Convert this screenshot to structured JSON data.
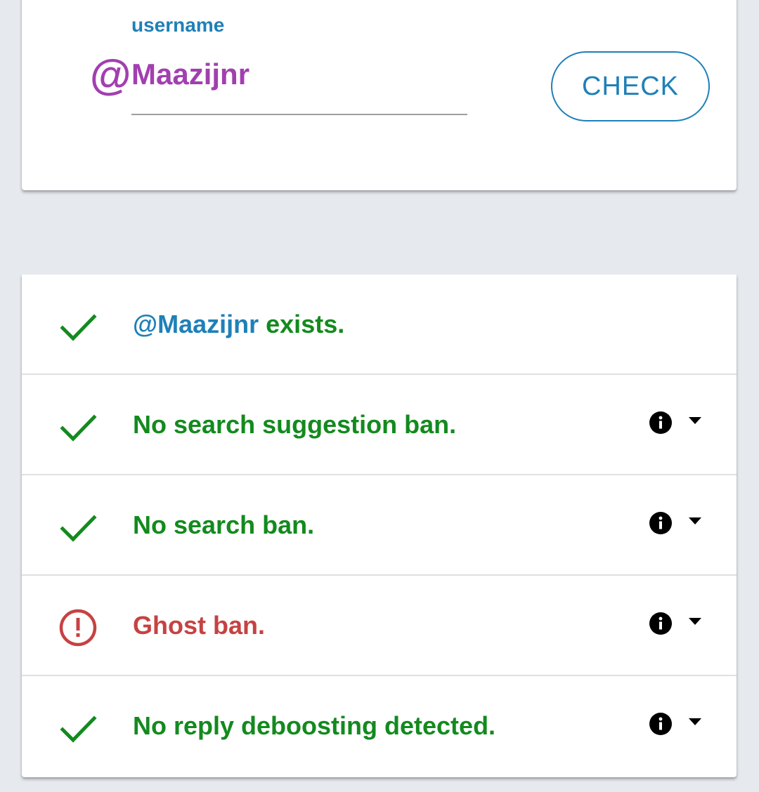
{
  "search": {
    "label": "username",
    "prefix_icon": "at-icon",
    "prefix_symbol": "@",
    "value": "Maazijnr",
    "button_label": "CHECK"
  },
  "results": {
    "exists": {
      "handle": "@Maazijnr",
      "text": " exists.",
      "status": "ok"
    },
    "suggestion_ban": {
      "text": "No search suggestion ban.",
      "status": "ok"
    },
    "search_ban": {
      "text": "No search ban.",
      "status": "ok"
    },
    "ghost_ban": {
      "text": "Ghost ban.",
      "status": "error"
    },
    "reply_deboosting": {
      "text": "No reply deboosting detected.",
      "status": "ok"
    }
  },
  "icons": {
    "ok": "check-icon",
    "error": "error-circle-icon",
    "info": "info-icon",
    "dropdown": "dropdown-arrow-icon"
  },
  "colors": {
    "background": "#e6eaee",
    "accent_blue": "#1f80b8",
    "accent_purple": "#a23fb0",
    "success_green": "#138a1e",
    "error_red": "#c64242"
  }
}
